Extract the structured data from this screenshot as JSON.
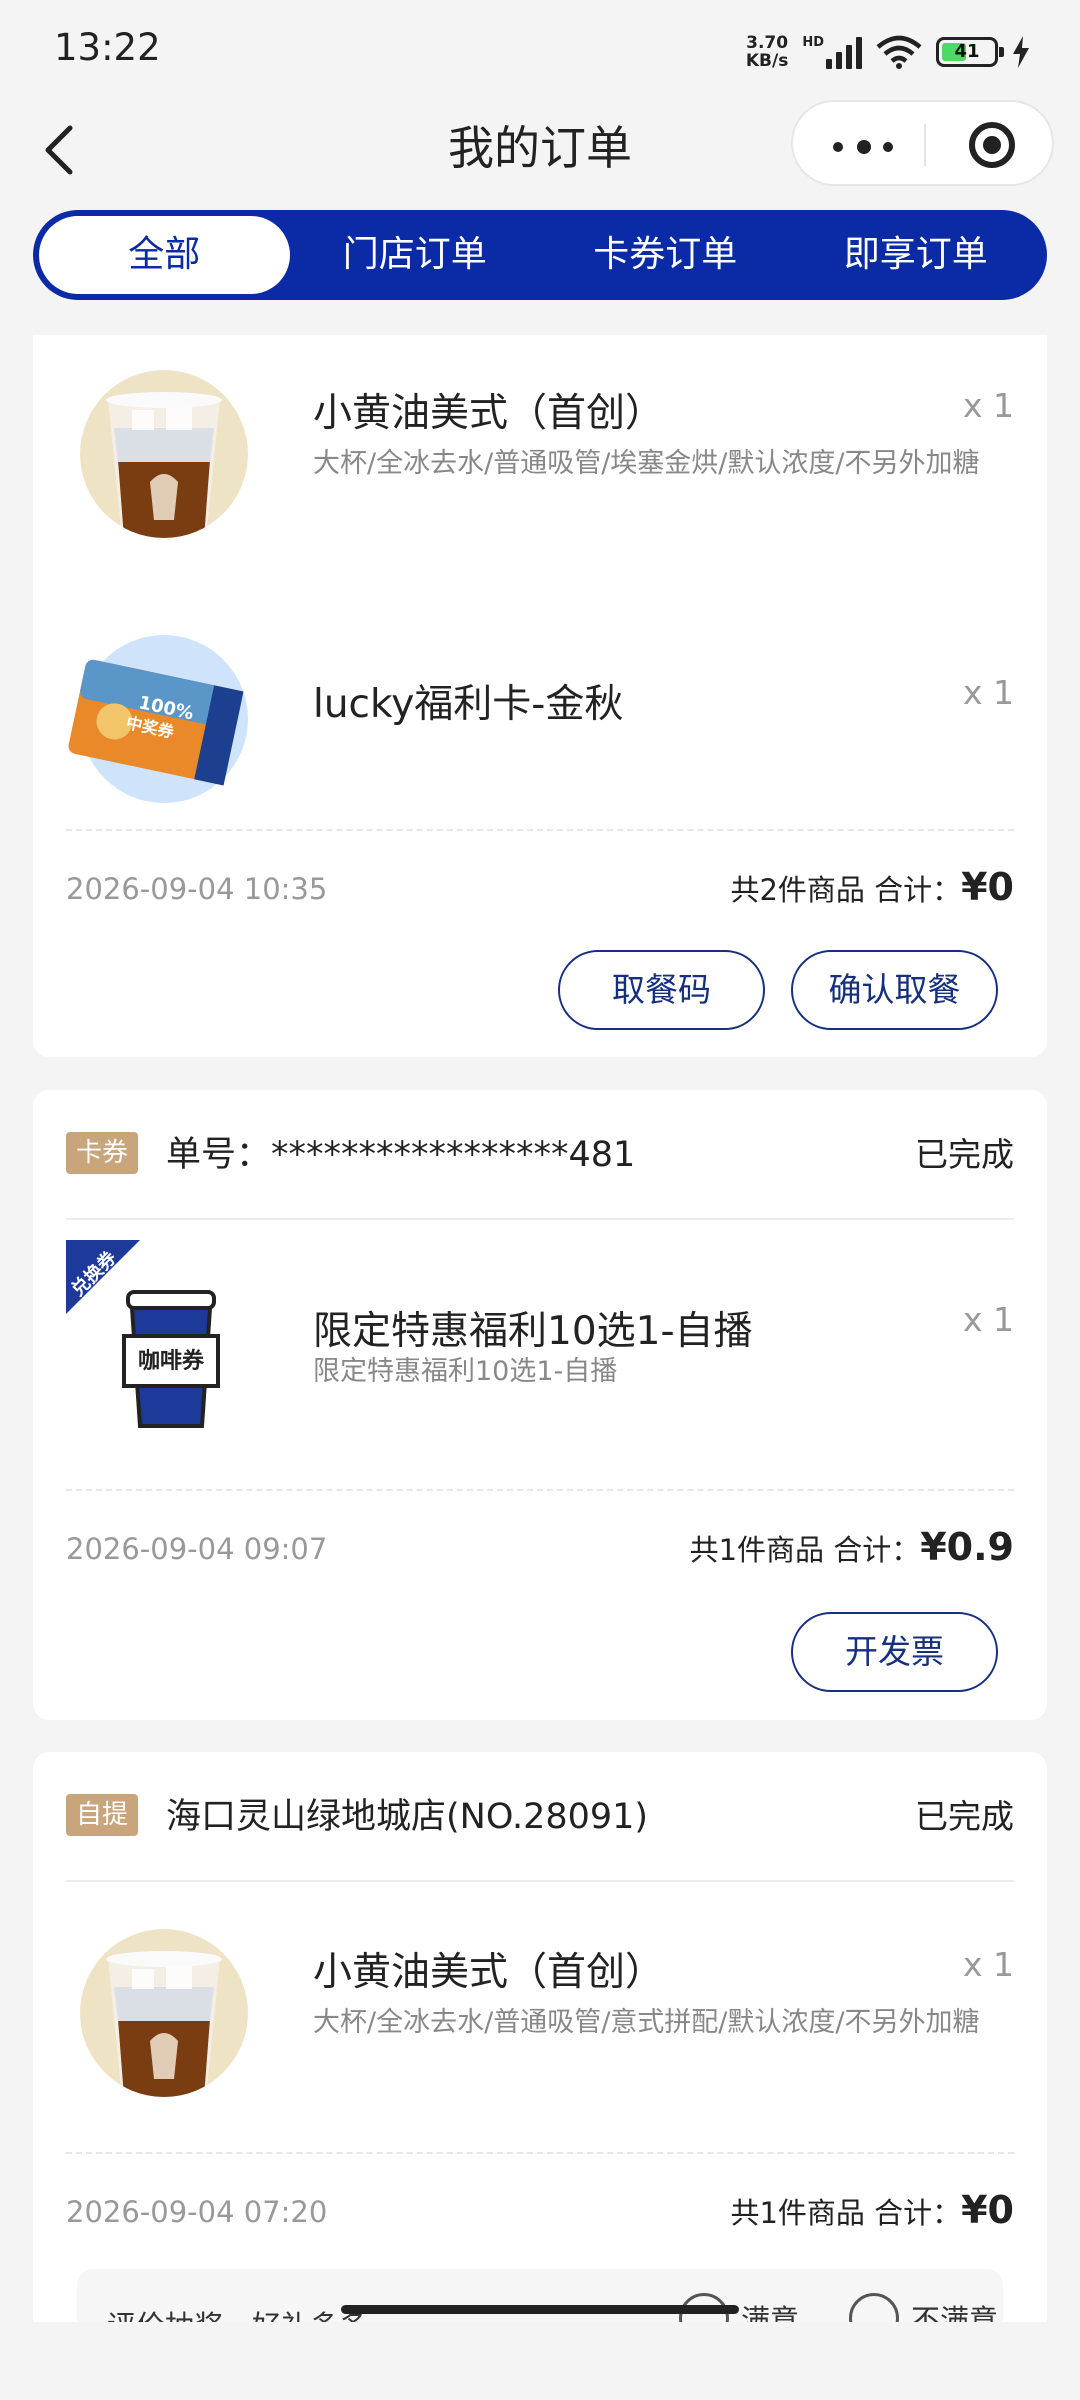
{
  "status_bar": {
    "time": "13:22",
    "net_speed_top": "3.70",
    "net_speed_bottom": "KB/s",
    "hd": "HD",
    "battery": "41"
  },
  "nav": {
    "title": "我的订单"
  },
  "tabs": [
    {
      "label": "全部",
      "active": true
    },
    {
      "label": "门店订单"
    },
    {
      "label": "卡券订单"
    },
    {
      "label": "即享订单"
    }
  ],
  "orders": [
    {
      "items": [
        {
          "name": "小黄油美式（首创）",
          "spec": "大杯/全冰去水/普通吸管/埃塞金烘/默认浓度/不另外加糖",
          "qty": "x 1",
          "image": "iced-coffee-cup"
        },
        {
          "name": "lucky福利卡-金秋",
          "spec": "",
          "qty": "x 1",
          "image": "welfare-card"
        }
      ],
      "date": "2026-09-04 10:35",
      "total_label": "共2件商品 合计：",
      "total_price": "¥0",
      "buttons": [
        "取餐码",
        "确认取餐"
      ]
    },
    {
      "tag": "卡券",
      "header": "单号：*****************481",
      "status": "已完成",
      "items": [
        {
          "name": "限定特惠福利10选1-自播",
          "spec": "限定特惠福利10选1-自播",
          "qty": "x 1",
          "image": "coffee-voucher",
          "ribbon": "兑换券",
          "cup_text": "咖啡券"
        }
      ],
      "date": "2026-09-04 09:07",
      "total_label": "共1件商品 合计：",
      "total_price": "¥0.9",
      "buttons": [
        "开发票"
      ]
    },
    {
      "tag": "自提",
      "header": "海口灵山绿地城店(NO.28091)",
      "status": "已完成",
      "items": [
        {
          "name": "小黄油美式（首创）",
          "spec": "大杯/全冰去水/普通吸管/意式拼配/默认浓度/不另外加糖",
          "qty": "x 1",
          "image": "iced-coffee-cup"
        }
      ],
      "date": "2026-09-04 07:20",
      "total_label": "共1件商品 合计：",
      "total_price": "¥0",
      "evaluation": {
        "prompt": "评价抽奖，好礼多多",
        "satisfied": "满意",
        "unsatisfied": "不满意"
      }
    }
  ],
  "colors": {
    "brand_blue": "#0b2aa6",
    "tag_gold": "#c9a57b",
    "button_border": "#16307f"
  }
}
